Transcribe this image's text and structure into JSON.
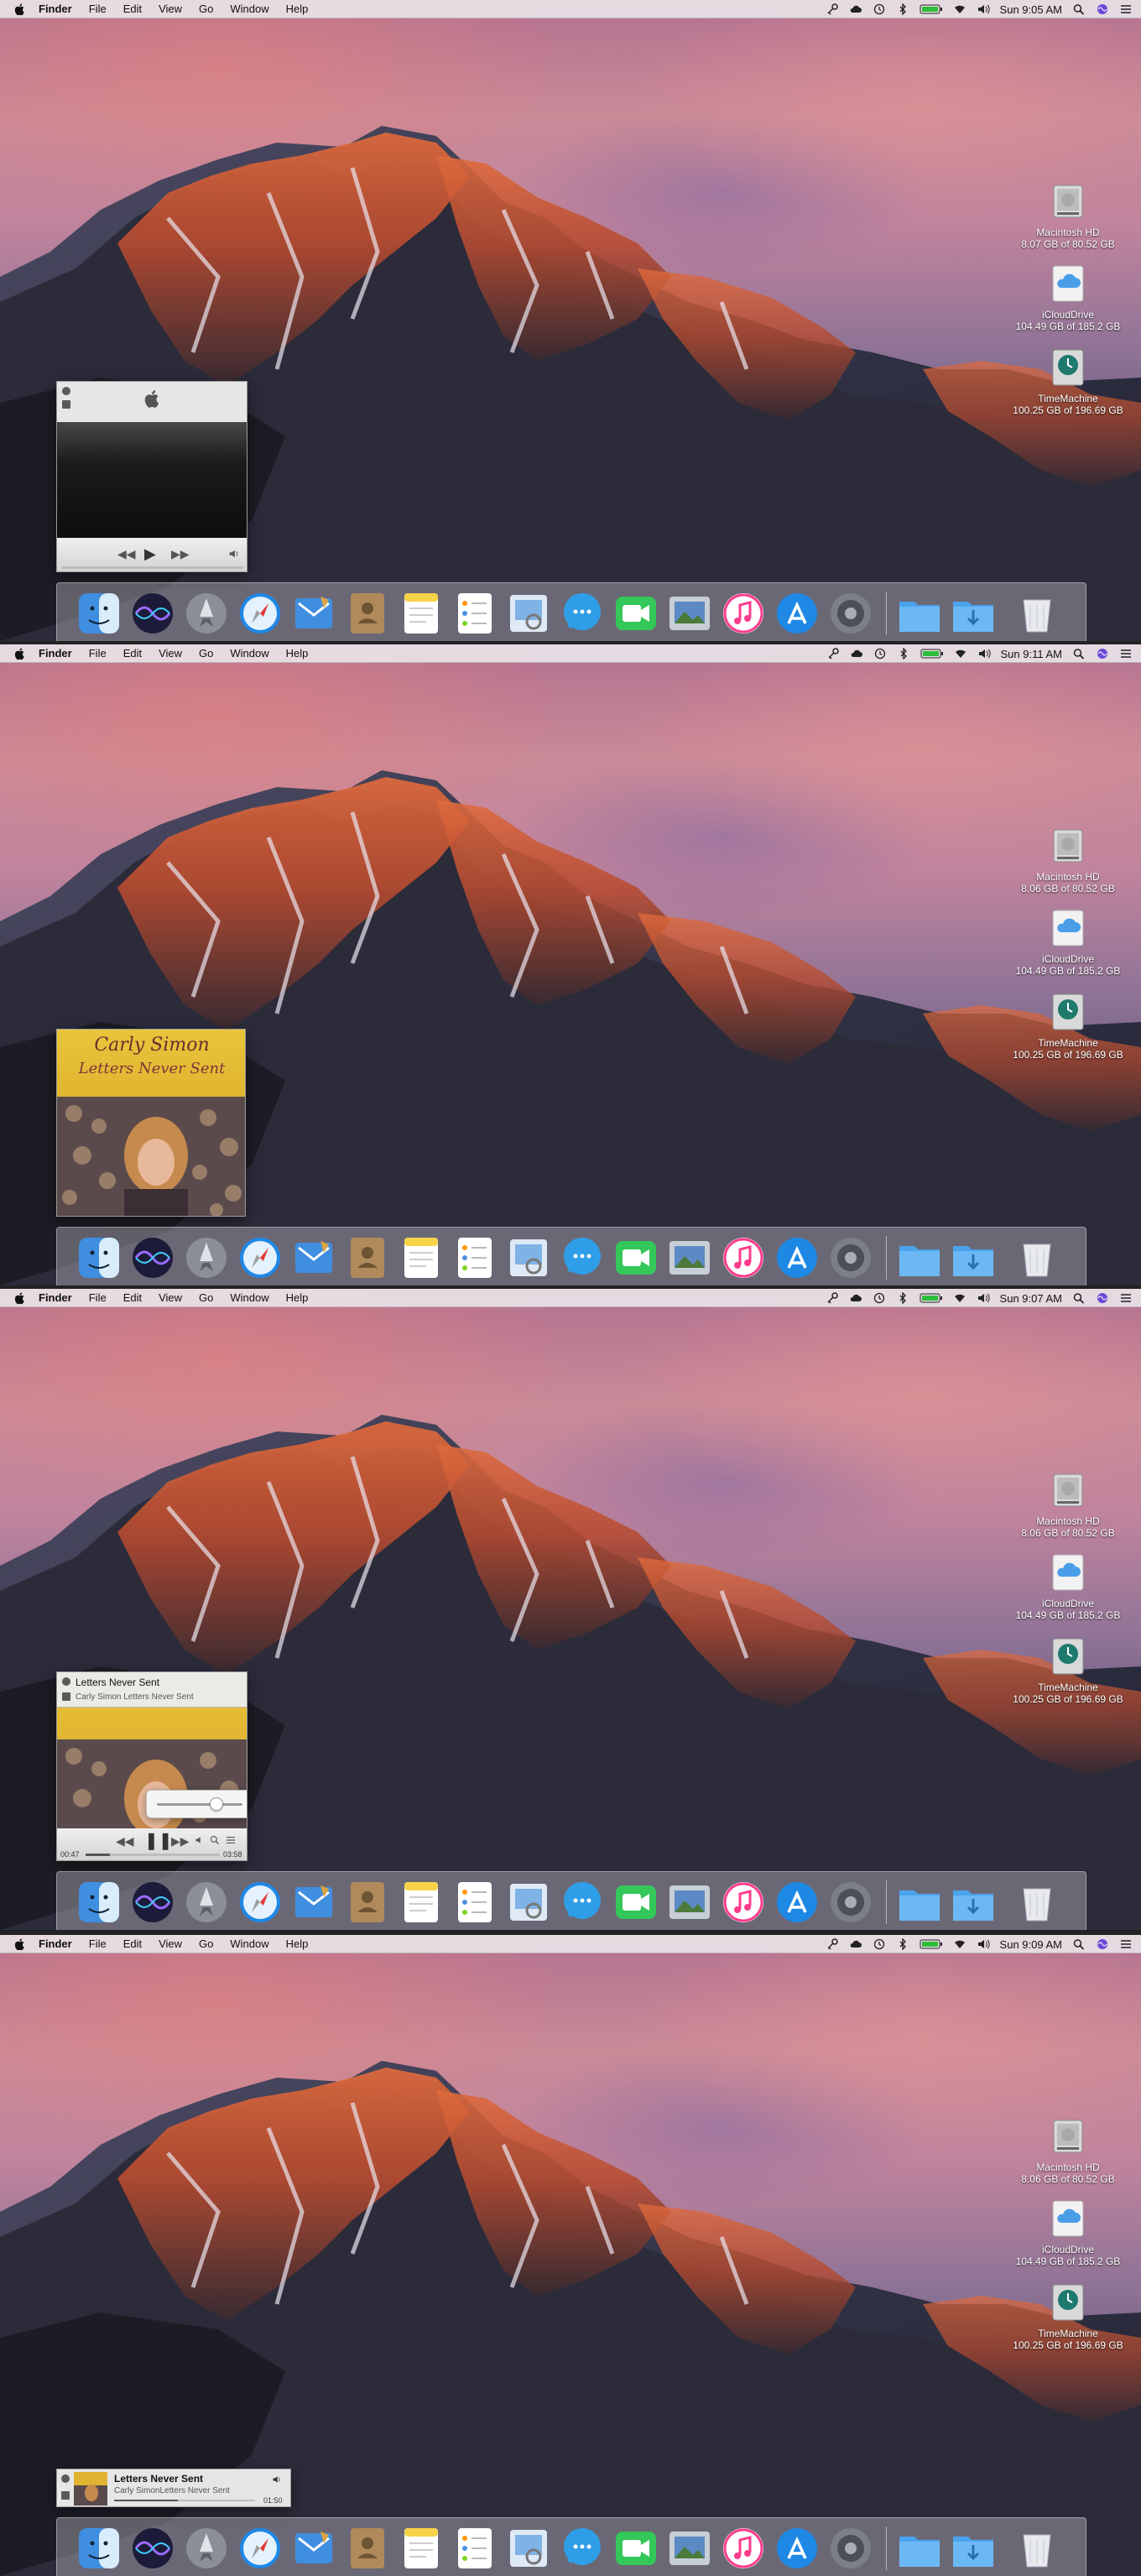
{
  "menubar": {
    "app_name": "Finder",
    "menus": [
      "File",
      "Edit",
      "View",
      "Go",
      "Window",
      "Help"
    ],
    "status_icons": [
      "key-icon",
      "cloud-icon",
      "time-machine-icon",
      "bluetooth-icon",
      "battery-icon",
      "wifi-icon",
      "volume-icon"
    ]
  },
  "desktop_icons": {
    "hd": {
      "label": "Macintosh HD"
    },
    "icloud": {
      "label": "iCloudDrive",
      "capacity": "104.49 GB of 185.2 GB"
    },
    "tm": {
      "label": "TimeMachine",
      "capacity": "100.25 GB of 196.69 GB"
    }
  },
  "dock": {
    "apps": [
      "finder-icon",
      "siri-icon",
      "launchpad-icon",
      "safari-icon",
      "mail-icon",
      "contacts-icon",
      "notes-icon",
      "reminders-icon",
      "preview-icon",
      "messages-icon",
      "facetime-icon",
      "photos-icon",
      "itunes-icon",
      "app-store-icon",
      "system-preferences-icon",
      "applications-folder-icon",
      "downloads-folder-icon",
      "trash-icon"
    ]
  },
  "screens": [
    {
      "time": "Sun 9:05 AM",
      "hd_capacity": "8.07 GB of 80.52 GB"
    },
    {
      "time": "Sun 9:11 AM",
      "hd_capacity": "8.06 GB of 80.52 GB"
    },
    {
      "time": "Sun 9:07 AM",
      "hd_capacity": "8.06 GB of 80.52 GB"
    },
    {
      "time": "Sun 9:09 AM",
      "hd_capacity": "8.06 GB of 80.52 GB"
    }
  ],
  "album": {
    "artist_script": "Carly Simon",
    "title_script": "Letters Never Sent"
  },
  "player3": {
    "track": "Letters Never Sent",
    "meta": "Carly Simon  Letters Never Sent",
    "elapsed": "00:47",
    "remaining": "03:58",
    "progress": 0.18,
    "volume": 0.7
  },
  "player4": {
    "track": "Letters Never Sent",
    "meta": "Carly SimonLetters Never Sent",
    "elapsed": "01:50",
    "progress": 0.45
  },
  "colors": {
    "menubar": "#ece8ec",
    "battery": "#2ebd3a"
  }
}
